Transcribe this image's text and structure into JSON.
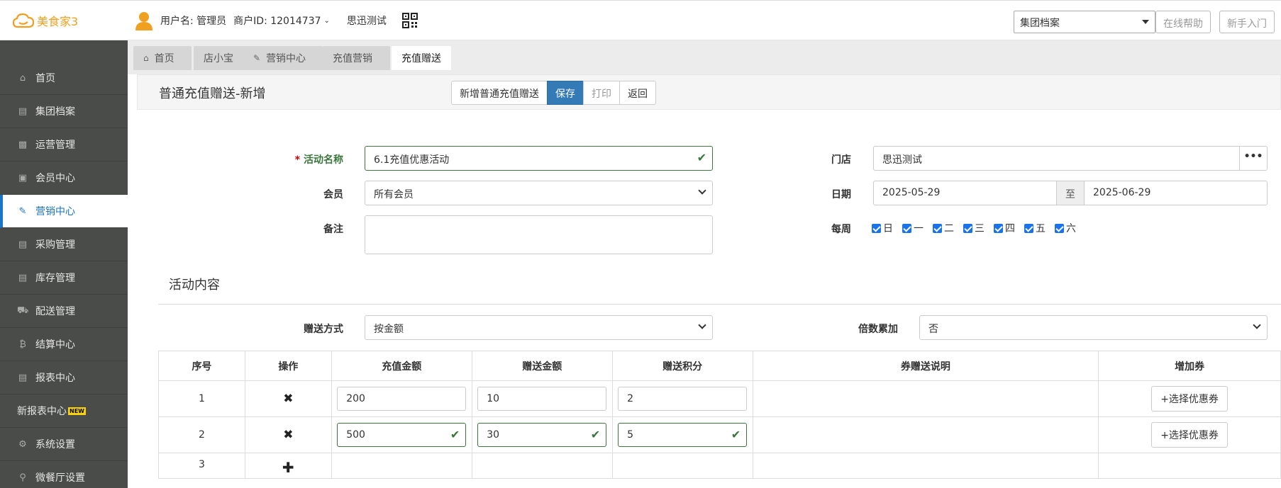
{
  "header": {
    "logo_text": "美食家3",
    "user_label": "用户名: 管理员",
    "merchant_label": "商户ID: 12014737",
    "store_name": "思迅测试",
    "select_value": "集团档案",
    "help_button": "在线帮助",
    "guide_button": "新手入门"
  },
  "sidebar": {
    "items": [
      {
        "label": "首页",
        "icon": "home-icon"
      },
      {
        "label": "集团档案",
        "icon": "file-icon"
      },
      {
        "label": "运营管理",
        "icon": "bar-chart-icon"
      },
      {
        "label": "会员中心",
        "icon": "id-card-icon"
      },
      {
        "label": "营销中心",
        "icon": "edit-icon",
        "active": true
      },
      {
        "label": "采购管理",
        "icon": "book-icon"
      },
      {
        "label": "库存管理",
        "icon": "file-icon"
      },
      {
        "label": "配送管理",
        "icon": "truck-icon"
      },
      {
        "label": "结算中心",
        "icon": "bitcoin-icon"
      },
      {
        "label": "报表中心",
        "icon": "file-text-icon"
      },
      {
        "label": "新报表中心",
        "badge": "NEW"
      },
      {
        "label": "系统设置",
        "icon": "gears-icon"
      },
      {
        "label": "微餐厅设置",
        "icon": "cutlery-icon"
      }
    ]
  },
  "tabs": [
    {
      "label": "首页",
      "icon": "home-icon"
    },
    {
      "label": "店小宝"
    },
    {
      "label": "营销中心",
      "icon": "edit-icon"
    },
    {
      "label": "充值营销"
    },
    {
      "label": "充值赠送",
      "active": true
    }
  ],
  "page": {
    "title": "普通充值赠送-新增",
    "buttons": {
      "new": "新增普通充值赠送",
      "save": "保存",
      "print": "打印",
      "back": "返回"
    }
  },
  "form": {
    "activity_name_label": "活动名称",
    "activity_name_value": "6.1充值优惠活动",
    "member_label": "会员",
    "member_value": "所有会员",
    "note_label": "备注",
    "note_value": "",
    "store_label": "门店",
    "store_value": "思迅测试",
    "store_more": "•••",
    "date_label": "日期",
    "date_from": "2025-05-29",
    "date_sep": "至",
    "date_to": "2025-06-29",
    "weekly_label": "每周",
    "weekdays": [
      "日",
      "一",
      "二",
      "三",
      "四",
      "五",
      "六"
    ]
  },
  "content": {
    "section_title": "活动内容",
    "gift_mode_label": "赠送方式",
    "gift_mode_value": "按金额",
    "multiple_label": "倍数累加",
    "multiple_value": "否",
    "table": {
      "headers": [
        "序号",
        "操作",
        "充值金额",
        "赠送金额",
        "赠送积分",
        "券赠送说明",
        "增加券"
      ],
      "rows": [
        {
          "index": "1",
          "recharge": "200",
          "gift": "10",
          "points": "2",
          "coupon_note": "",
          "coupon_btn": "+选择优惠券"
        },
        {
          "index": "2",
          "recharge": "500",
          "gift": "30",
          "points": "5",
          "coupon_note": "",
          "coupon_btn": "+选择优惠券"
        },
        {
          "index": "3"
        }
      ]
    }
  },
  "colors": {
    "primary": "#337ab7",
    "active_blue": "#1a73c6",
    "sidebar_bg": "#4a4c49",
    "success_green": "#3c763d",
    "logo_orange": "#f0a020"
  }
}
